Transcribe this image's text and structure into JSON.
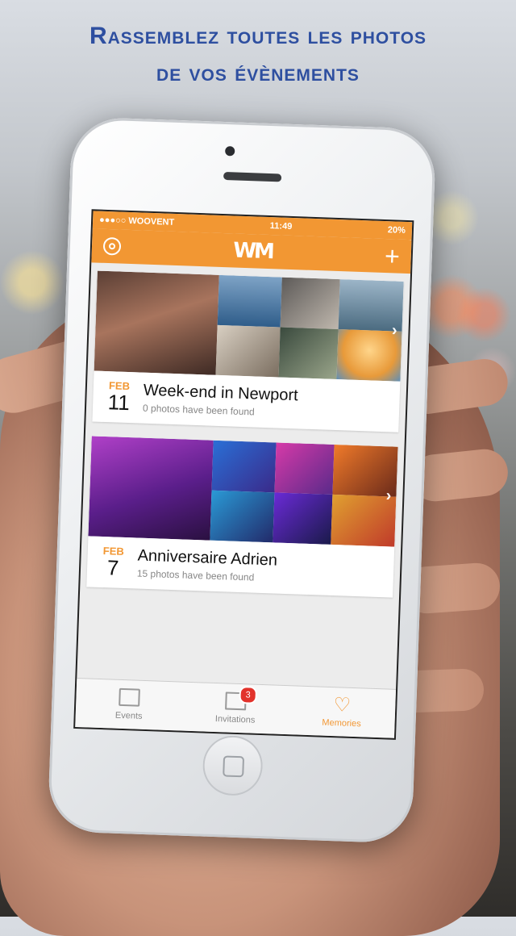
{
  "headline": {
    "line1": "Rassemblez toutes les photos",
    "line2": "de vos évènements"
  },
  "status": {
    "carrier": "●●●○○ WOOVENT",
    "time": "11:49",
    "battery": "20%"
  },
  "navbar": {
    "logo": "WM"
  },
  "events": [
    {
      "month": "FEB",
      "day": "11",
      "title": "Week-end in Newport",
      "subtitle": "0 photos have been found"
    },
    {
      "month": "FEB",
      "day": "7",
      "title": "Anniversaire Adrien",
      "subtitle": "15 photos have been found"
    }
  ],
  "tabs": [
    {
      "label": "Events",
      "icon": "calendar-icon"
    },
    {
      "label": "Invitations",
      "icon": "envelope-icon",
      "badge": "3"
    },
    {
      "label": "Memories",
      "icon": "heart-icon"
    }
  ],
  "colors": {
    "accent": "#f29733",
    "badge": "#e2322b",
    "headline": "#2e4fa0"
  }
}
